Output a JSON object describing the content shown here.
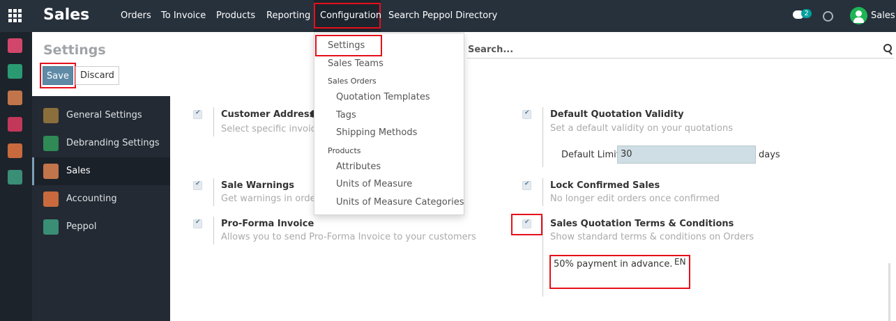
{
  "topbar": {
    "app_title": "Sales",
    "menu": [
      "Orders",
      "To Invoice",
      "Products",
      "Reporting",
      "Configuration",
      "Search Peppol Directory"
    ],
    "chat_count": "2",
    "user_name": "Sales"
  },
  "control_panel": {
    "title": "Settings",
    "save_label": "Save",
    "discard_label": "Discard",
    "search_placeholder": "Search..."
  },
  "config_menu": {
    "settings": "Settings",
    "sales_teams": "Sales Teams",
    "sales_orders_header": "Sales Orders",
    "quotation_templates": "Quotation Templates",
    "tags": "Tags",
    "shipping_methods": "Shipping Methods",
    "products_header": "Products",
    "attributes": "Attributes",
    "units_of_measure": "Units of Measure",
    "uom_categories": "Units of Measure Categories"
  },
  "sidebar": {
    "items": [
      {
        "label": "General Settings",
        "icon": "gear-icon",
        "color": "#8a6e3c"
      },
      {
        "label": "Debranding Settings",
        "icon": "tag-icon",
        "color": "#2f8a55"
      },
      {
        "label": "Sales",
        "icon": "chart-icon",
        "color": "#c2744a"
      },
      {
        "label": "Accounting",
        "icon": "invoice-icon",
        "color": "#c86a3d"
      },
      {
        "label": "Peppol",
        "icon": "document-icon",
        "color": "#3a8e76"
      }
    ]
  },
  "settings": {
    "customer_addresses": {
      "title": "Customer Addresses",
      "desc": "Select specific invoice a"
    },
    "default_validity": {
      "title": "Default Quotation Validity",
      "desc": "Set a default validity on your quotations",
      "limit_label": "Default Limit:",
      "limit_value": "30",
      "unit": "days"
    },
    "sale_warnings": {
      "title": "Sale Warnings",
      "desc": "Get warnings in orders"
    },
    "lock_confirmed": {
      "title": "Lock Confirmed Sales",
      "desc": "No longer edit orders once confirmed"
    },
    "proforma": {
      "title": "Pro-Forma Invoice",
      "desc": "Allows you to send Pro-Forma Invoice to your customers"
    },
    "terms": {
      "title": "Sales Quotation Terms & Conditions",
      "desc": "Show standard terms & conditions on Orders",
      "text": "50% payment in advance.",
      "lang": "EN"
    }
  },
  "colors": {
    "topbar": "#27313c",
    "sidebar": "#232a33",
    "highlight": "#e5101a",
    "save": "#5f8aa6"
  }
}
